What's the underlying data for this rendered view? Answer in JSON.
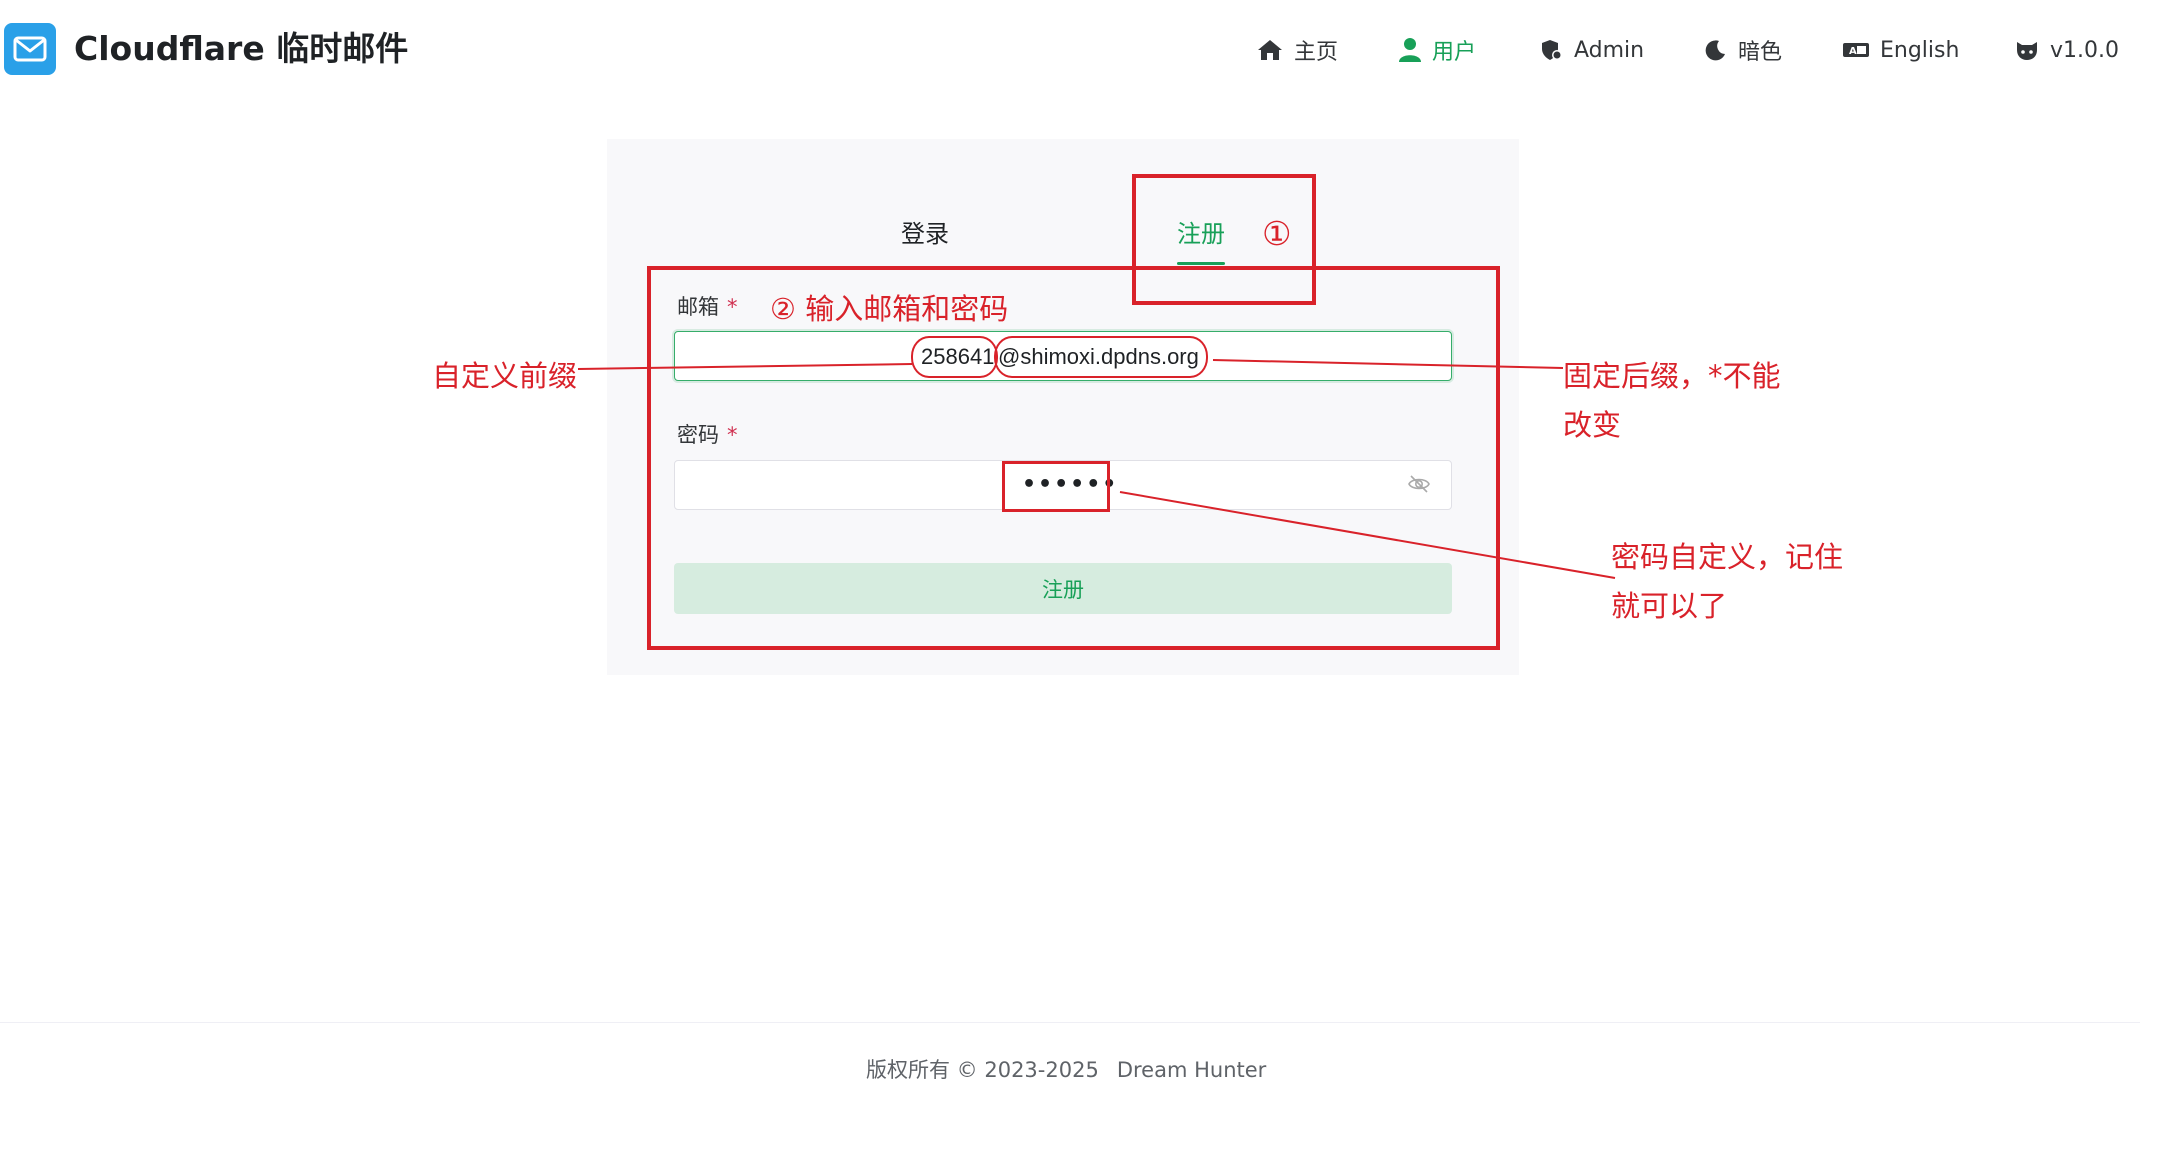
{
  "header": {
    "brand": "Cloudflare 临时邮件",
    "nav": [
      {
        "label": "主页",
        "icon": "home-icon"
      },
      {
        "label": "用户",
        "icon": "user-icon",
        "active": true
      },
      {
        "label": "Admin",
        "icon": "shield-icon"
      },
      {
        "label": "暗色",
        "icon": "moon-icon"
      },
      {
        "label": "English",
        "icon": "translate-icon"
      },
      {
        "label": "v1.0.0",
        "icon": "github-icon"
      }
    ]
  },
  "form": {
    "tabs": {
      "login": "登录",
      "register": "注册"
    },
    "email_label": "邮箱",
    "password_label": "密码",
    "required_mark": "*",
    "email_prefix": "258641",
    "email_suffix": "@shimoxi.dpdns.org",
    "password_masked": "••••••",
    "submit_label": "注册"
  },
  "annotations": {
    "step1": "①",
    "step2": "② 输入邮箱和密码",
    "custom_prefix": "自定义前缀",
    "fixed_suffix_line1": "固定后缀，*不能",
    "fixed_suffix_line2": "改变",
    "password_note_line1": "密码自定义，记住",
    "password_note_line2": "就可以了"
  },
  "footer": {
    "copyright": "版权所有 © 2023-2025",
    "author": "Dream Hunter"
  },
  "colors": {
    "accent": "#18a058",
    "annotation": "#d9222a",
    "logo": "#2aa0e8"
  }
}
